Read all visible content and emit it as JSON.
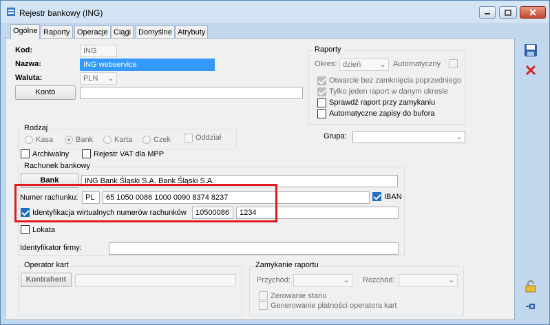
{
  "window": {
    "title": "Rejestr bankowy (ING)"
  },
  "tabs": [
    "Ogólne",
    "Raporty",
    "Operacje",
    "Ciągi",
    "Domyślne",
    "Atrybuty"
  ],
  "form": {
    "kod_label": "Kod:",
    "kod_value": "ING",
    "nazwa_label": "Nazwa:",
    "nazwa_value": "ING webservice",
    "waluta_label": "Waluta:",
    "waluta_value": "PLN",
    "konto_button": "Konto",
    "konto_value": ""
  },
  "raporty": {
    "title": "Raporty",
    "okres_label": "Okres:",
    "okres_value": "dzień",
    "automatyczny_label": "Automatyczny",
    "options": [
      {
        "label": "Otwarcie bez zamknięcia poprzedniego",
        "checked": true,
        "disabled": true
      },
      {
        "label": "Tylko jeden raport w danym okresie",
        "checked": true,
        "disabled": true
      },
      {
        "label": "Sprawdź raport przy zamykaniu",
        "checked": false,
        "disabled": false
      },
      {
        "label": "Automatyczne zapisy do bufora",
        "checked": false,
        "disabled": false
      }
    ]
  },
  "grupa": {
    "label": "Grupa:",
    "value": ""
  },
  "rodzaj": {
    "title": "Rodzaj",
    "options": [
      "Kasa",
      "Bank",
      "Karta",
      "Czek"
    ],
    "oddzial": "Oddział"
  },
  "checks": {
    "archiwalny": "Archiwalny",
    "rejestr_vat": "Rejestr VAT dla MPP"
  },
  "rachunek": {
    "title": "Rachunek bankowy",
    "bank_button": "Bank",
    "bank_value": "ING Bank Śląski S.A. Bank Śląski S.A.",
    "numer_label": "Numer rachunku:",
    "country": "PL",
    "numer_value": "65 1050 0086 1000 0090 8374 8237",
    "iban_label": "IBAN",
    "identyfikacja_label": "Identyfikacja wirtualnych numerów rachunków",
    "identyfikacja_value1": "10500086",
    "identyfikacja_value2": "1234",
    "lokata_label": "Lokata",
    "identyfikator_label": "Identyfikator firmy:",
    "identyfikator_value": ""
  },
  "operator": {
    "title": "Operator kart",
    "kontrahent_button": "Kontrahent",
    "value": ""
  },
  "zamykanie": {
    "title": "Zamykanie raportu",
    "przychod_label": "Przychód:",
    "rozchod_label": "Rozchód:",
    "zerowanie_label": "Zerowanie stanu",
    "generowanie_label": "Generowanie płatności operatora kart"
  },
  "colors": {
    "accent": "#1e6ec8",
    "highlight": "#e01b1b",
    "selection": "#3399ff"
  }
}
